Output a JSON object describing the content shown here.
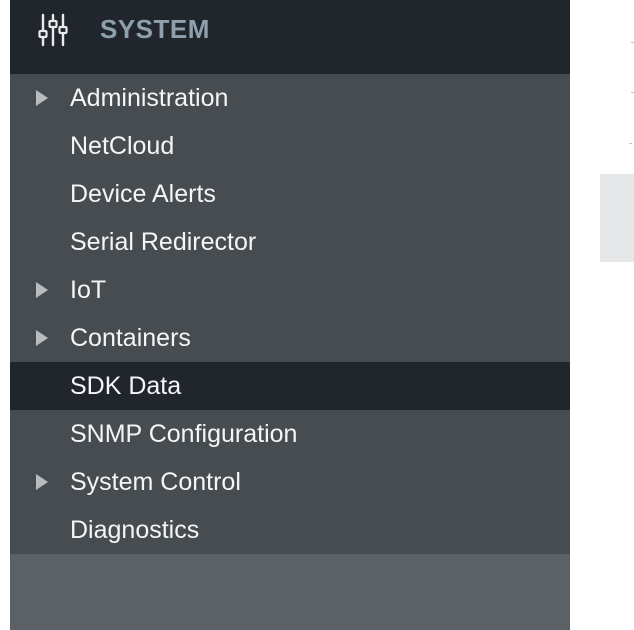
{
  "sidebar": {
    "header": {
      "title": "SYSTEM",
      "icon": "sliders-icon"
    },
    "items": [
      {
        "label": "Administration",
        "expandable": true,
        "active": false
      },
      {
        "label": "NetCloud",
        "expandable": false,
        "active": false
      },
      {
        "label": "Device Alerts",
        "expandable": false,
        "active": false
      },
      {
        "label": "Serial Redirector",
        "expandable": false,
        "active": false
      },
      {
        "label": "IoT",
        "expandable": true,
        "active": false
      },
      {
        "label": "Containers",
        "expandable": true,
        "active": false
      },
      {
        "label": "SDK Data",
        "expandable": false,
        "active": true
      },
      {
        "label": "SNMP Configuration",
        "expandable": false,
        "active": false
      },
      {
        "label": "System Control",
        "expandable": true,
        "active": false
      },
      {
        "label": "Diagnostics",
        "expandable": false,
        "active": false
      }
    ]
  },
  "colors": {
    "header_bg": "#21262c",
    "menu_bg": "#474c51",
    "active_bg": "#21262c",
    "footer_bg": "#5c6166",
    "header_text": "#8fa0ad",
    "menu_text": "#f4f5f6",
    "arrow": "#b8bcbf"
  }
}
